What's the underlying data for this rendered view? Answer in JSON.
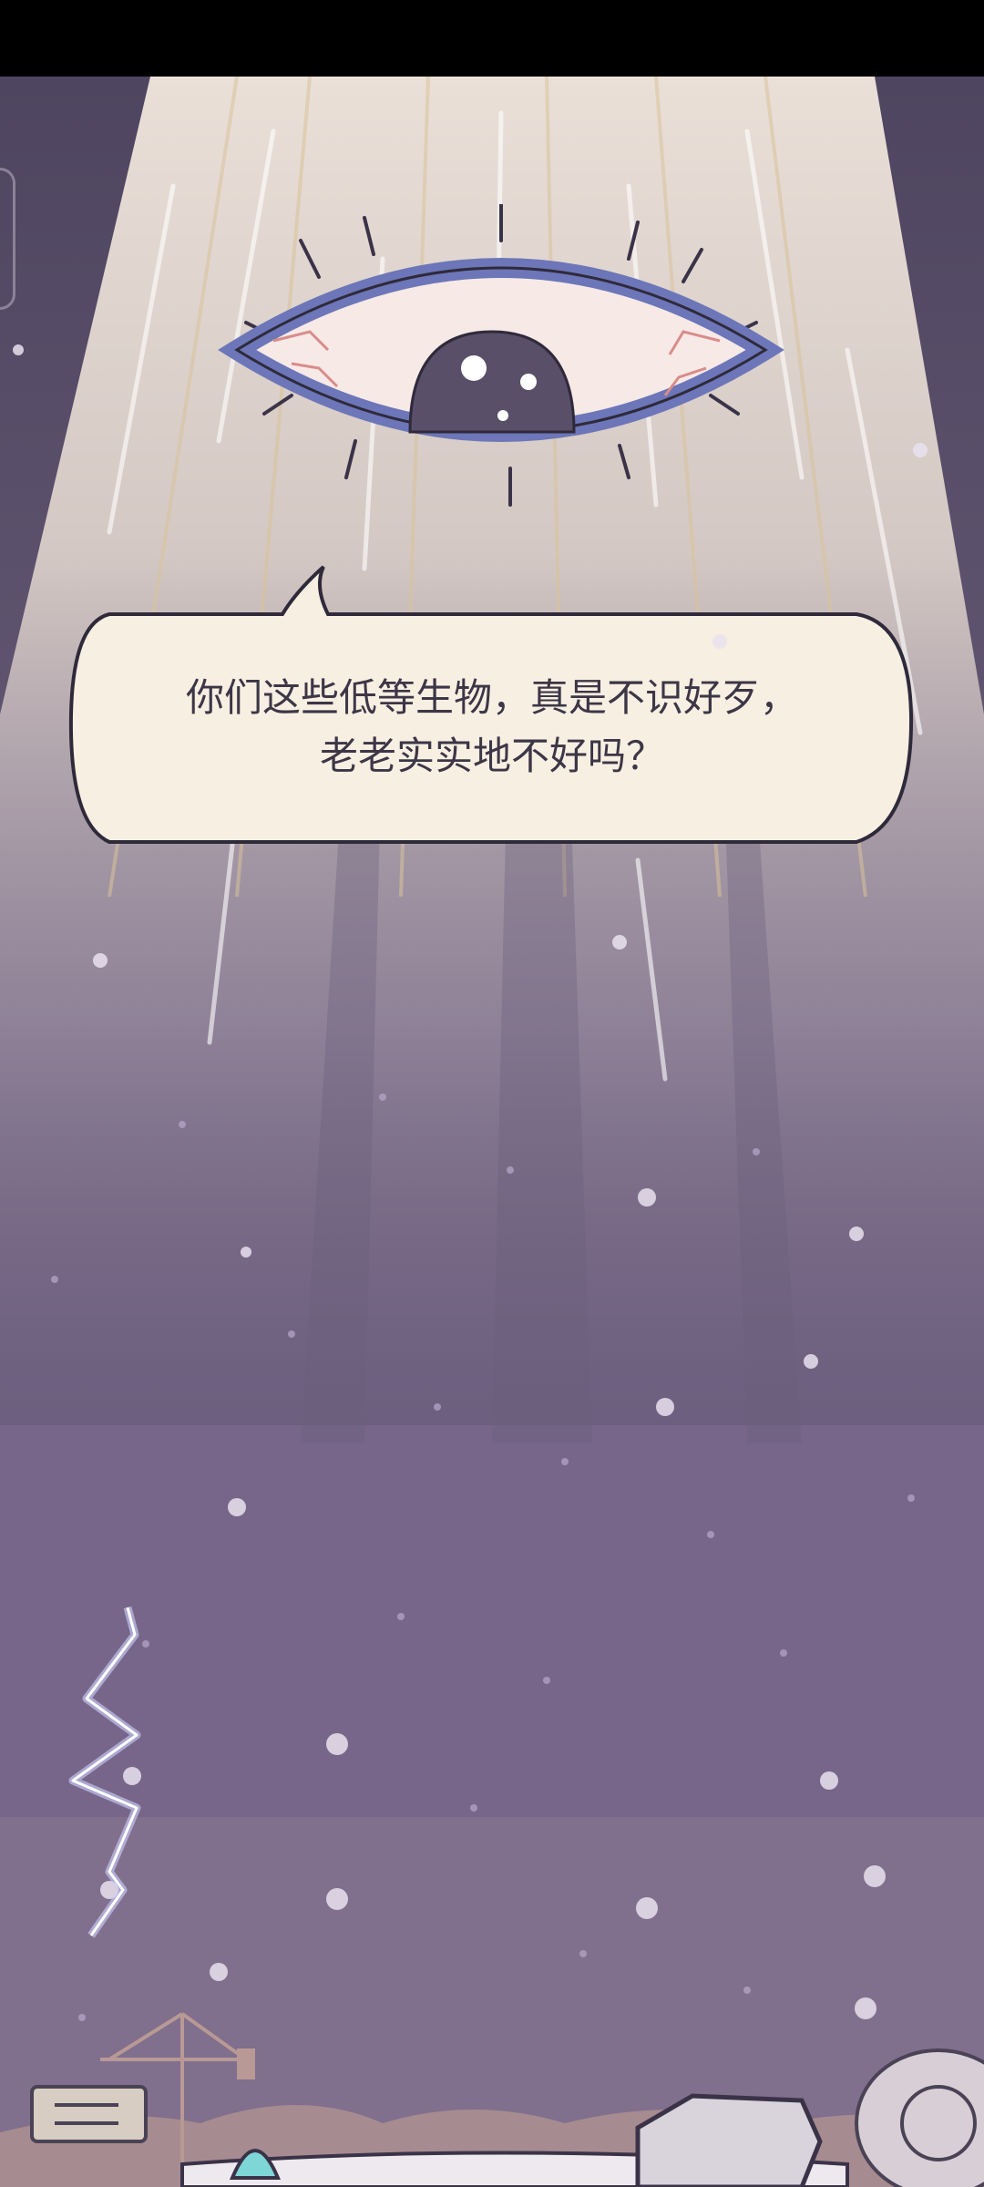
{
  "dialog": {
    "lines": [
      "你们这些低等生物，真是不识好歹，",
      "老老实实地不好吗？"
    ]
  },
  "colors": {
    "sky_top": "#4e4560",
    "sky_bottom": "#756587",
    "beam": "#efe6dd",
    "bubble_fill": "#f7efe2",
    "eye_rim": "#6c76b8",
    "pupil": "#5a4f68"
  },
  "icons": [
    "eye-icon",
    "lightning-bolt-icon",
    "sign-icon",
    "crane-icon",
    "rock-icon",
    "dome-icon"
  ]
}
